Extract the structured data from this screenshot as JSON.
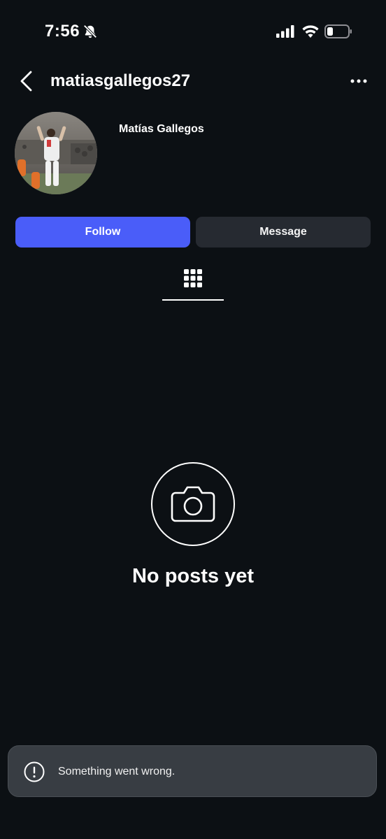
{
  "status_bar": {
    "time": "7:56"
  },
  "header": {
    "username": "matiasgallegos27"
  },
  "profile": {
    "display_name": "Matías Gallegos"
  },
  "actions": {
    "follow_label": "Follow",
    "message_label": "Message"
  },
  "empty_state": {
    "title": "No posts yet"
  },
  "toast": {
    "message": "Something went wrong."
  },
  "colors": {
    "background": "#0c1014",
    "follow_button": "#4a5df9",
    "message_button": "#262a31",
    "toast_background": "#383d43"
  }
}
